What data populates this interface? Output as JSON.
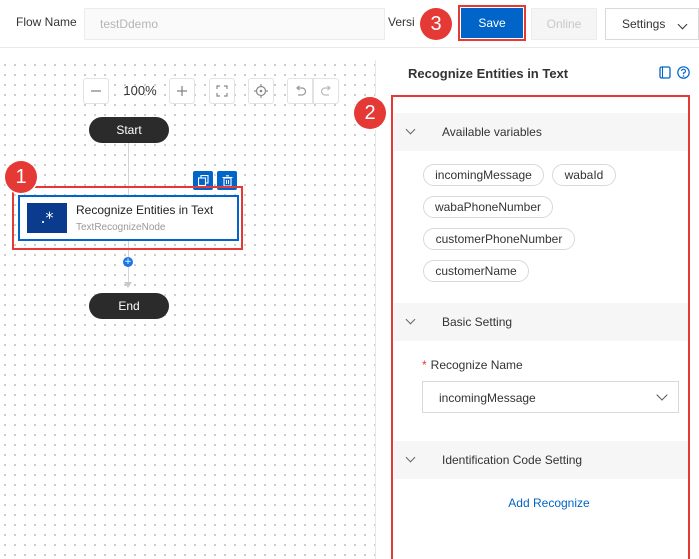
{
  "topbar": {
    "flow_name_label": "Flow Name",
    "flow_name_value": "testDdemo",
    "version_label": "Version",
    "save_label": "Save",
    "online_label": "Online",
    "settings_label": "Settings"
  },
  "canvas": {
    "zoom": "100%",
    "start_label": "Start",
    "end_label": "End",
    "node": {
      "title": "Recognize Entities in Text",
      "subtitle": "TextRecognizeNode",
      "icon_text": ".*"
    }
  },
  "panel": {
    "title": "Recognize Entities in Text",
    "sections": {
      "variables": "Available variables",
      "basic": "Basic Setting",
      "identification": "Identification Code Setting"
    },
    "variables": [
      "incomingMessage",
      "wabaId",
      "wabaPhoneNumber",
      "customerPhoneNumber",
      "customerName"
    ],
    "field_label": "Recognize Name",
    "field_value": "incomingMessage",
    "add_link": "Add Recognize"
  },
  "callouts": [
    "1",
    "2",
    "3"
  ],
  "colors": {
    "primary": "#0064c8",
    "callout": "#e53935",
    "node_icon": "#0b3b8c"
  }
}
